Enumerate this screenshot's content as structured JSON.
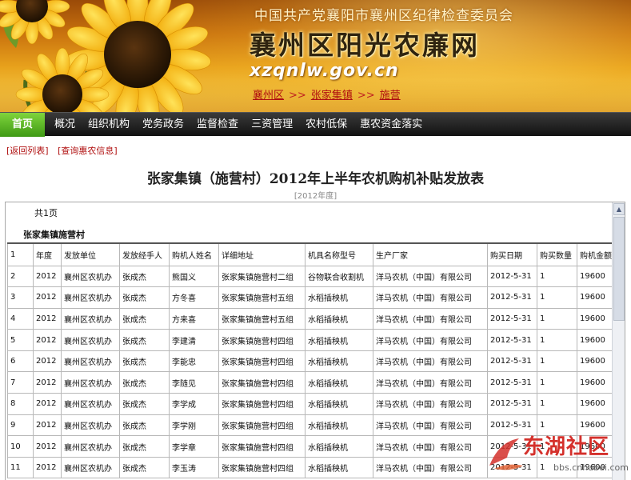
{
  "header": {
    "org": "中国共产党襄阳市襄州区纪律检查委员会",
    "site_title": "襄州区阳光农廉网",
    "url": "xzqnlw.gov.cn",
    "breadcrumb": [
      "襄州区",
      "张家集镇",
      "施营"
    ],
    "breadcrumb_sep": ">>"
  },
  "nav": {
    "items": [
      "首页",
      "概况",
      "组织机构",
      "党务政务",
      "监督检查",
      "三资管理",
      "农村低保",
      "惠农资金落实"
    ]
  },
  "links": {
    "back": "[返回列表]",
    "query": "[查询惠农信息]"
  },
  "document": {
    "title": "张家集镇（施营村）2012年上半年农机购机补贴发放表",
    "year": "[2012年度]",
    "page_count": "共1页",
    "group": "张家集镇施营村"
  },
  "table": {
    "header": [
      "1",
      "年度",
      "发放单位",
      "发放经手人",
      "购机人姓名",
      "详细地址",
      "机具名称型号",
      "生产厂家",
      "购买日期",
      "购买数量",
      "购机金额"
    ],
    "rows": [
      [
        "2",
        "2012",
        "襄州区农机办",
        "张成杰",
        "熊国义",
        "张家集镇施营村二组",
        "谷物联合收割机",
        "洋马农机（中国）有限公司",
        "2012-5-31",
        "1",
        "19600"
      ],
      [
        "3",
        "2012",
        "襄州区农机办",
        "张成杰",
        "方冬喜",
        "张家集镇施营村五组",
        "水稻插秧机",
        "洋马农机（中国）有限公司",
        "2012-5-31",
        "1",
        "19600"
      ],
      [
        "4",
        "2012",
        "襄州区农机办",
        "张成杰",
        "方来喜",
        "张家集镇施营村五组",
        "水稻插秧机",
        "洋马农机（中国）有限公司",
        "2012-5-31",
        "1",
        "19600"
      ],
      [
        "5",
        "2012",
        "襄州区农机办",
        "张成杰",
        "李建清",
        "张家集镇施营村四组",
        "水稻插秧机",
        "洋马农机（中国）有限公司",
        "2012-5-31",
        "1",
        "19600"
      ],
      [
        "6",
        "2012",
        "襄州区农机办",
        "张成杰",
        "李能忠",
        "张家集镇施营村四组",
        "水稻插秧机",
        "洋马农机（中国）有限公司",
        "2012-5-31",
        "1",
        "19600"
      ],
      [
        "7",
        "2012",
        "襄州区农机办",
        "张成杰",
        "李随见",
        "张家集镇施营村四组",
        "水稻插秧机",
        "洋马农机（中国）有限公司",
        "2012-5-31",
        "1",
        "19600"
      ],
      [
        "8",
        "2012",
        "襄州区农机办",
        "张成杰",
        "李学成",
        "张家集镇施营村四组",
        "水稻插秧机",
        "洋马农机（中国）有限公司",
        "2012-5-31",
        "1",
        "19600"
      ],
      [
        "9",
        "2012",
        "襄州区农机办",
        "张成杰",
        "李学刚",
        "张家集镇施营村四组",
        "水稻插秧机",
        "洋马农机（中国）有限公司",
        "2012-5-31",
        "1",
        "19600"
      ],
      [
        "10",
        "2012",
        "襄州区农机办",
        "张成杰",
        "李学章",
        "张家集镇施营村四组",
        "水稻插秧机",
        "洋马农机（中国）有限公司",
        "2012-5-31",
        "1",
        "19600"
      ],
      [
        "11",
        "2012",
        "襄州区农机办",
        "张成杰",
        "李玉涛",
        "张家集镇施营村四组",
        "水稻插秧机",
        "洋马农机（中国）有限公司",
        "2012-5-31",
        "1",
        "19600"
      ]
    ]
  },
  "watermark": {
    "text": "东湖社区",
    "url": "bbs.cnhubei.com"
  },
  "colors": {
    "nav_bg": "#1a1a1a",
    "nav_active": "#4fa81c",
    "link_red": "#b01010",
    "watermark_red": "#d4302b"
  }
}
